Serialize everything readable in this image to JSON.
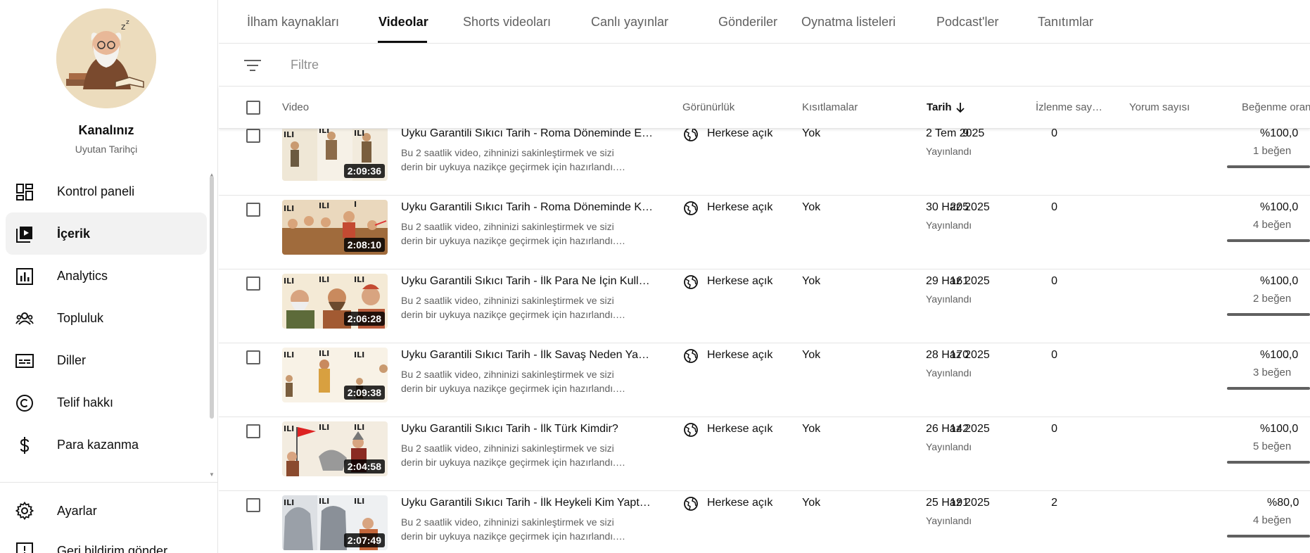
{
  "channel": {
    "title": "Kanalınız",
    "name": "Uyutan Tarihçi"
  },
  "sidebar": {
    "items": [
      {
        "label": "Kontrol paneli",
        "icon": "dashboard-icon"
      },
      {
        "label": "İçerik",
        "icon": "content-icon",
        "active": true
      },
      {
        "label": "Analytics",
        "icon": "analytics-icon"
      },
      {
        "label": "Topluluk",
        "icon": "community-icon"
      },
      {
        "label": "Diller",
        "icon": "subtitles-icon"
      },
      {
        "label": "Telif hakkı",
        "icon": "copyright-icon"
      },
      {
        "label": "Para kazanma",
        "icon": "dollar-icon"
      }
    ],
    "settings_label": "Ayarlar",
    "feedback_label": "Geri bildirim gönder"
  },
  "tabs": [
    "İlham kaynakları",
    "Videolar",
    "Shorts videoları",
    "Canlı yayınlar",
    "Gönderiler",
    "Oynatma listeleri",
    "Podcast'ler",
    "Tanıtımlar"
  ],
  "active_tab": "Videolar",
  "filter": {
    "placeholder": "Filtre"
  },
  "columns": {
    "video": "Video",
    "visibility": "Görünürlük",
    "restrictions": "Kısıtlamalar",
    "date": "Tarih",
    "views": "İzlenme say…",
    "comments": "Yorum sayısı",
    "likes": "Beğenme oran"
  },
  "videos": [
    {
      "title": "Uyku Garantili Sıkıcı Tarih - Roma Döneminde E…",
      "desc1": "Bu 2 saatlik video, zihninizi sakinleştirmek ve sizi",
      "desc2": "derin bir uykuya nazikçe geçirmek için hazırlandı.…",
      "duration": "2:09:36",
      "visibility": "Herkese açık",
      "restrictions": "Yok",
      "date": "2 Tem 2025",
      "status": "Yayınlandı",
      "views": "9",
      "comments": "0",
      "like_ratio": "%100,0",
      "like_count": "1 beğen"
    },
    {
      "title": "Uyku Garantili Sıkıcı Tarih - Roma Döneminde K…",
      "desc1": "Bu 2 saatlik video, zihninizi sakinleştirmek ve sizi",
      "desc2": "derin bir uykuya nazikçe geçirmek için hazırlandı.…",
      "duration": "2:08:10",
      "visibility": "Herkese açık",
      "restrictions": "Yok",
      "date": "30 Haz 2025",
      "status": "Yayınlandı",
      "views": "205",
      "comments": "0",
      "like_ratio": "%100,0",
      "like_count": "4 beğen"
    },
    {
      "title": "Uyku Garantili Sıkıcı Tarih - İlk Para Ne İçin Kull…",
      "desc1": "Bu 2 saatlik video, zihninizi sakinleştirmek ve sizi",
      "desc2": "derin bir uykuya nazikçe geçirmek için hazırlandı.…",
      "duration": "2:06:28",
      "visibility": "Herkese açık",
      "restrictions": "Yok",
      "date": "29 Haz 2025",
      "status": "Yayınlandı",
      "views": "161",
      "comments": "0",
      "like_ratio": "%100,0",
      "like_count": "2 beğen"
    },
    {
      "title": "Uyku Garantili Sıkıcı Tarih - İlk Savaş Neden Ya…",
      "desc1": "Bu 2 saatlik video, zihninizi sakinleştirmek ve sizi",
      "desc2": "derin bir uykuya nazikçe geçirmek için hazırlandı.…",
      "duration": "2:09:38",
      "visibility": "Herkese açık",
      "restrictions": "Yok",
      "date": "28 Haz 2025",
      "status": "Yayınlandı",
      "views": "170",
      "comments": "0",
      "like_ratio": "%100,0",
      "like_count": "3 beğen"
    },
    {
      "title": "Uyku Garantili Sıkıcı Tarih - İlk Türk Kimdir?",
      "desc1": "Bu 2 saatlik video, zihninizi sakinleştirmek ve sizi",
      "desc2": "derin bir uykuya nazikçe geçirmek için hazırlandı.…",
      "duration": "2:04:58",
      "visibility": "Herkese açık",
      "restrictions": "Yok",
      "date": "26 Haz 2025",
      "status": "Yayınlandı",
      "views": "142",
      "comments": "0",
      "like_ratio": "%100,0",
      "like_count": "5 beğen"
    },
    {
      "title": "Uyku Garantili Sıkıcı Tarih - İlk Heykeli Kim Yapt…",
      "desc1": "Bu 2 saatlik video, zihninizi sakinleştirmek ve sizi",
      "desc2": "derin bir uykuya nazikçe geçirmek için hazırlandı.…",
      "duration": "2:07:49",
      "visibility": "Herkese açık",
      "restrictions": "Yok",
      "date": "25 Haz 2025",
      "status": "Yayınlandı",
      "views": "191",
      "comments": "2",
      "like_ratio": "%80,0",
      "like_count": "4 beğen"
    }
  ],
  "colors": {
    "text": "#0f0f0f",
    "secondary": "#606060",
    "divider": "#e5e5e5",
    "active_bg": "#f2f2f2"
  }
}
